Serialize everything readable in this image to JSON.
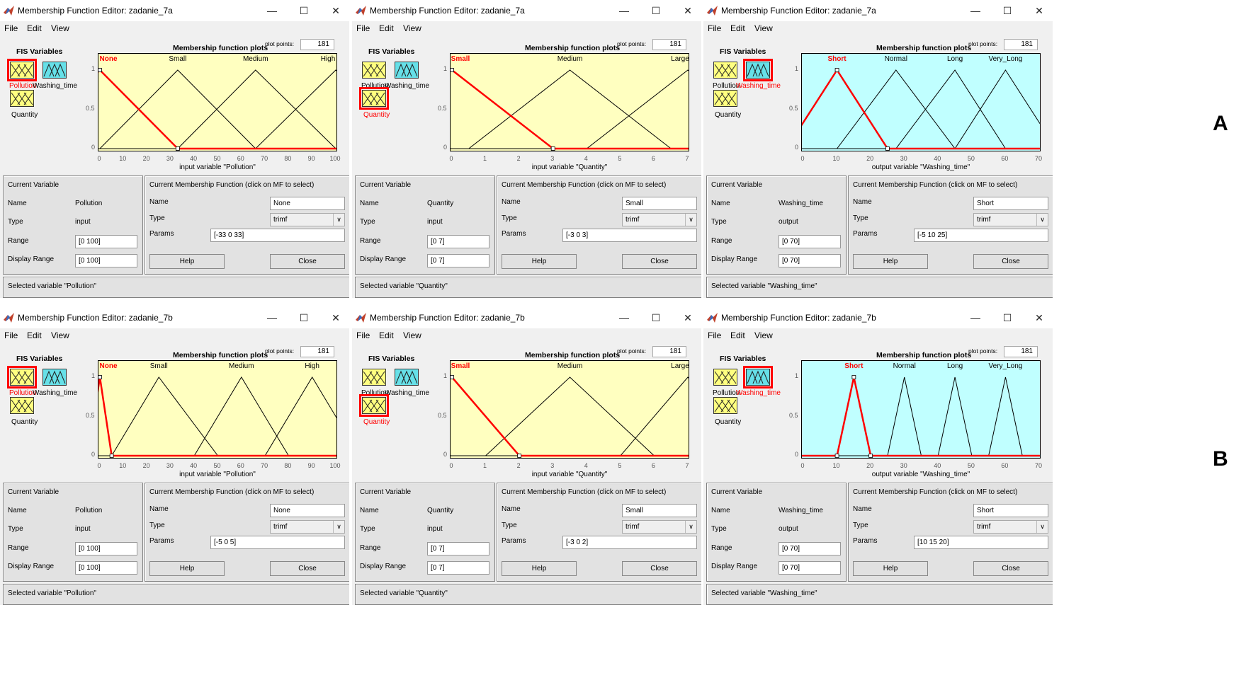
{
  "windows": [
    {
      "title": "Membership Function Editor: zadanie_7a",
      "menu": [
        "File",
        "Edit",
        "View"
      ],
      "fis_variables_label": "FIS Variables",
      "variables": [
        {
          "label": "Pollution",
          "kind": "input",
          "selected": true
        },
        {
          "label": "Washing_time",
          "kind": "output",
          "selected": false
        },
        {
          "label": "Quantity",
          "kind": "input",
          "selected": false
        }
      ],
      "plot_title": "Membership function plots",
      "plot_points_label": "plot points:",
      "plot_points": "181",
      "axis_label": "input variable \"Pollution\"",
      "bg_color": "#ffffc0",
      "x_range": [
        0,
        100
      ],
      "x_ticks": [
        "0",
        "10",
        "20",
        "30",
        "40",
        "50",
        "60",
        "70",
        "80",
        "90",
        "100"
      ],
      "y_ticks": [
        "1",
        "0.5",
        "0"
      ],
      "mfs": [
        {
          "name": "None",
          "params": [
            -33,
            0,
            33
          ],
          "selected": true
        },
        {
          "name": "Small",
          "params": [
            0,
            33,
            66
          ],
          "selected": false
        },
        {
          "name": "Medium",
          "params": [
            33,
            66,
            100
          ],
          "selected": false
        },
        {
          "name": "High",
          "params": [
            66,
            100,
            133
          ],
          "selected": false
        }
      ],
      "current_variable": {
        "title": "Current Variable",
        "name_label": "Name",
        "name": "Pollution",
        "type_label": "Type",
        "type": "input",
        "range_label": "Range",
        "range": "[0 100]",
        "display_range_label": "Display Range",
        "display_range": "[0 100]"
      },
      "current_mf": {
        "title": "Current Membership Function (click on MF to select)",
        "name_label": "Name",
        "name": "None",
        "type_label": "Type",
        "type": "trimf",
        "params_label": "Params",
        "params": "[-33 0 33]"
      },
      "help_label": "Help",
      "close_label": "Close",
      "status": "Selected variable \"Pollution\""
    },
    {
      "title": "Membership Function Editor: zadanie_7a",
      "menu": [
        "File",
        "Edit",
        "View"
      ],
      "fis_variables_label": "FIS Variables",
      "variables": [
        {
          "label": "Pollution",
          "kind": "input",
          "selected": false
        },
        {
          "label": "Washing_time",
          "kind": "output",
          "selected": false
        },
        {
          "label": "Quantity",
          "kind": "input",
          "selected": true
        }
      ],
      "plot_title": "Membership function plots",
      "plot_points_label": "plot points:",
      "plot_points": "181",
      "axis_label": "input variable \"Quantity\"",
      "bg_color": "#ffffc0",
      "x_range": [
        0,
        7
      ],
      "x_ticks": [
        "0",
        "1",
        "2",
        "3",
        "4",
        "5",
        "6",
        "7"
      ],
      "y_ticks": [
        "1",
        "0.5",
        "0"
      ],
      "mfs": [
        {
          "name": "Small",
          "params": [
            -3,
            0,
            3
          ],
          "selected": true
        },
        {
          "name": "Medium",
          "params": [
            0.5,
            3.5,
            6.5
          ],
          "selected": false
        },
        {
          "name": "Large",
          "params": [
            4,
            7,
            10
          ],
          "selected": false
        }
      ],
      "current_variable": {
        "title": "Current Variable",
        "name_label": "Name",
        "name": "Quantity",
        "type_label": "Type",
        "type": "input",
        "range_label": "Range",
        "range": "[0 7]",
        "display_range_label": "Display Range",
        "display_range": "[0 7]"
      },
      "current_mf": {
        "title": "Current Membership Function (click on MF to select)",
        "name_label": "Name",
        "name": "Small",
        "type_label": "Type",
        "type": "trimf",
        "params_label": "Params",
        "params": "[-3 0 3]"
      },
      "help_label": "Help",
      "close_label": "Close",
      "status": "Selected variable \"Quantity\""
    },
    {
      "title": "Membership Function Editor: zadanie_7a",
      "menu": [
        "File",
        "Edit",
        "View"
      ],
      "fis_variables_label": "FIS Variables",
      "variables": [
        {
          "label": "Pollution",
          "kind": "input",
          "selected": false
        },
        {
          "label": "Washing_time",
          "kind": "output",
          "selected": true
        },
        {
          "label": "Quantity",
          "kind": "input",
          "selected": false
        }
      ],
      "plot_title": "Membership function plots",
      "plot_points_label": "plot points:",
      "plot_points": "181",
      "axis_label": "output variable \"Washing_time\"",
      "bg_color": "#c0ffff",
      "x_range": [
        0,
        70
      ],
      "x_ticks": [
        "0",
        "10",
        "20",
        "30",
        "40",
        "50",
        "60",
        "70"
      ],
      "y_ticks": [
        "1",
        "0.5",
        "0"
      ],
      "mfs": [
        {
          "name": "Short",
          "params": [
            -5,
            10,
            25
          ],
          "selected": true
        },
        {
          "name": "Normal",
          "params": [
            10,
            27.5,
            45
          ],
          "selected": false
        },
        {
          "name": "Long",
          "params": [
            27.5,
            45,
            60
          ],
          "selected": false
        },
        {
          "name": "Very_Long",
          "params": [
            45,
            60,
            75
          ],
          "selected": false
        }
      ],
      "current_variable": {
        "title": "Current Variable",
        "name_label": "Name",
        "name": "Washing_time",
        "type_label": "Type",
        "type": "output",
        "range_label": "Range",
        "range": "[0 70]",
        "display_range_label": "Display Range",
        "display_range": "[0 70]"
      },
      "current_mf": {
        "title": "Current Membership Function (click on MF to select)",
        "name_label": "Name",
        "name": "Short",
        "type_label": "Type",
        "type": "trimf",
        "params_label": "Params",
        "params": "[-5 10 25]"
      },
      "help_label": "Help",
      "close_label": "Close",
      "status": "Selected variable \"Washing_time\""
    },
    {
      "title": "Membership Function Editor: zadanie_7b",
      "menu": [
        "File",
        "Edit",
        "View"
      ],
      "fis_variables_label": "FIS Variables",
      "variables": [
        {
          "label": "Pollution",
          "kind": "input",
          "selected": true
        },
        {
          "label": "Washing_time",
          "kind": "output",
          "selected": false
        },
        {
          "label": "Quantity",
          "kind": "input",
          "selected": false
        }
      ],
      "plot_title": "Membership function plots",
      "plot_points_label": "plot points:",
      "plot_points": "181",
      "axis_label": "input variable \"Pollution\"",
      "bg_color": "#ffffc0",
      "x_range": [
        0,
        100
      ],
      "x_ticks": [
        "0",
        "10",
        "20",
        "30",
        "40",
        "50",
        "60",
        "70",
        "80",
        "90",
        "100"
      ],
      "y_ticks": [
        "1",
        "0.5",
        "0"
      ],
      "mfs": [
        {
          "name": "None",
          "params": [
            -5,
            0,
            5
          ],
          "selected": true
        },
        {
          "name": "Small",
          "params": [
            5,
            25,
            50
          ],
          "selected": false
        },
        {
          "name": "Medium",
          "params": [
            40,
            60,
            80
          ],
          "selected": false
        },
        {
          "name": "High",
          "params": [
            70,
            90,
            110
          ],
          "selected": false
        }
      ],
      "current_variable": {
        "title": "Current Variable",
        "name_label": "Name",
        "name": "Pollution",
        "type_label": "Type",
        "type": "input",
        "range_label": "Range",
        "range": "[0 100]",
        "display_range_label": "Display Range",
        "display_range": "[0 100]"
      },
      "current_mf": {
        "title": "Current Membership Function (click on MF to select)",
        "name_label": "Name",
        "name": "None",
        "type_label": "Type",
        "type": "trimf",
        "params_label": "Params",
        "params": "[-5 0 5]"
      },
      "help_label": "Help",
      "close_label": "Close",
      "status": "Selected variable \"Pollution\""
    },
    {
      "title": "Membership Function Editor: zadanie_7b",
      "menu": [
        "File",
        "Edit",
        "View"
      ],
      "fis_variables_label": "FIS Variables",
      "variables": [
        {
          "label": "Pollution",
          "kind": "input",
          "selected": false
        },
        {
          "label": "Washing_time",
          "kind": "output",
          "selected": false
        },
        {
          "label": "Quantity",
          "kind": "input",
          "selected": true
        }
      ],
      "plot_title": "Membership function plots",
      "plot_points_label": "plot points:",
      "plot_points": "181",
      "axis_label": "input variable \"Quantity\"",
      "bg_color": "#ffffc0",
      "x_range": [
        0,
        7
      ],
      "x_ticks": [
        "0",
        "1",
        "2",
        "3",
        "4",
        "5",
        "6",
        "7"
      ],
      "y_ticks": [
        "1",
        "0.5",
        "0"
      ],
      "mfs": [
        {
          "name": "Small",
          "params": [
            -3,
            0,
            2
          ],
          "selected": true
        },
        {
          "name": "Medium",
          "params": [
            1,
            3.5,
            6
          ],
          "selected": false
        },
        {
          "name": "Large",
          "params": [
            5,
            7,
            9
          ],
          "selected": false
        }
      ],
      "current_variable": {
        "title": "Current Variable",
        "name_label": "Name",
        "name": "Quantity",
        "type_label": "Type",
        "type": "input",
        "range_label": "Range",
        "range": "[0 7]",
        "display_range_label": "Display Range",
        "display_range": "[0 7]"
      },
      "current_mf": {
        "title": "Current Membership Function (click on MF to select)",
        "name_label": "Name",
        "name": "Small",
        "type_label": "Type",
        "type": "trimf",
        "params_label": "Params",
        "params": "[-3 0 2]"
      },
      "help_label": "Help",
      "close_label": "Close",
      "status": "Selected variable \"Quantity\""
    },
    {
      "title": "Membership Function Editor: zadanie_7b",
      "menu": [
        "File",
        "Edit",
        "View"
      ],
      "fis_variables_label": "FIS Variables",
      "variables": [
        {
          "label": "Pollution",
          "kind": "input",
          "selected": false
        },
        {
          "label": "Washing_time",
          "kind": "output",
          "selected": true
        },
        {
          "label": "Quantity",
          "kind": "input",
          "selected": false
        }
      ],
      "plot_title": "Membership function plots",
      "plot_points_label": "plot points:",
      "plot_points": "181",
      "axis_label": "output variable \"Washing_time\"",
      "bg_color": "#c0ffff",
      "x_range": [
        0,
        70
      ],
      "x_ticks": [
        "0",
        "10",
        "20",
        "30",
        "40",
        "50",
        "60",
        "70"
      ],
      "y_ticks": [
        "1",
        "0.5",
        "0"
      ],
      "mfs": [
        {
          "name": "Short",
          "params": [
            10,
            15,
            20
          ],
          "selected": true
        },
        {
          "name": "Normal",
          "params": [
            25,
            30,
            35
          ],
          "selected": false
        },
        {
          "name": "Long",
          "params": [
            40,
            45,
            50
          ],
          "selected": false
        },
        {
          "name": "Very_Long",
          "params": [
            55,
            60,
            65
          ],
          "selected": false
        }
      ],
      "current_variable": {
        "title": "Current Variable",
        "name_label": "Name",
        "name": "Washing_time",
        "type_label": "Type",
        "type": "output",
        "range_label": "Range",
        "range": "[0 70]",
        "display_range_label": "Display Range",
        "display_range": "[0 70]"
      },
      "current_mf": {
        "title": "Current Membership Function (click on MF to select)",
        "name_label": "Name",
        "name": "Short",
        "type_label": "Type",
        "type": "trimf",
        "params_label": "Params",
        "params": "[10 15 20]"
      },
      "help_label": "Help",
      "close_label": "Close",
      "status": "Selected variable \"Washing_time\""
    }
  ],
  "row_labels": [
    "A",
    "B"
  ]
}
